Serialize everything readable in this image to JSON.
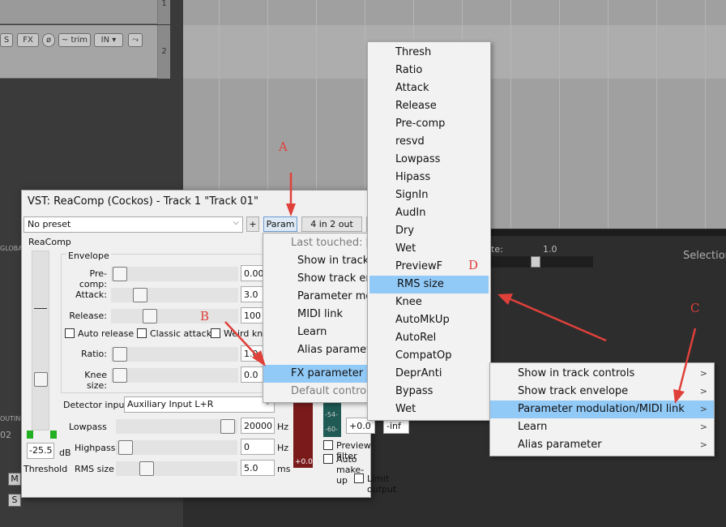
{
  "tcp": {
    "track1_num": "1",
    "track2_num": "2",
    "solo_label": "S",
    "fx_label": "FX",
    "trim_label": "trim",
    "input_label": "IN",
    "global_label": "GLOBAL",
    "routing_label": "OUTING",
    "mixer_num": "02",
    "mixer_m": "M",
    "mixer_s": "S"
  },
  "arrange": {
    "rate_label": "te:",
    "rate_value": "1.0",
    "selection_label": "Selection"
  },
  "fx_window": {
    "title": "VST: ReaComp (Cockos) - Track 1 \"Track 01\"",
    "preset": "No preset",
    "plus_label": "+",
    "param_label": "Param",
    "io_label": "4 in 2 out",
    "plugin_name": "ReaComp",
    "envelope_label": "Envelope",
    "precomp_label": "Pre-comp:",
    "precomp_value": "0.00",
    "attack_label": "Attack:",
    "attack_value": "3.0",
    "release_label": "Release:",
    "release_value": "100",
    "auto_release_label": "Auto release",
    "classic_attack_label": "Classic attack",
    "weird_knee_label": "Weird knee",
    "ratio_label": "Ratio:",
    "ratio_value": "1.0",
    "knee_label": "Knee size:",
    "knee_value": "0.0",
    "detector_label": "Detector input:",
    "detector_value": "Auxiliary Input L+R",
    "lowpass_label": "Lowpass",
    "lowpass_value": "20000",
    "highpass_label": "Highpass",
    "highpass_value": "0",
    "rms_label": "RMS size",
    "rms_value": "5.0",
    "hz_unit": "Hz",
    "ms_unit": "ms",
    "threshold_value": "-25.5",
    "threshold_db": "dB",
    "threshold_label": "Threshold",
    "meter_red_value": "+0.0",
    "meter_teal_top": "-54-",
    "meter_teal_bottom": "-60-",
    "out_value_1": "+0.0",
    "out_value_2": "-inf",
    "preview_filter_label": "Preview filter",
    "auto_makeup_label": "Auto make-up",
    "limit_output_label": "Limit output"
  },
  "param_menu": {
    "items": [
      {
        "label": "Last touched: [Th",
        "state": "disabled"
      },
      {
        "label": "Show in track c",
        "state": "normal"
      },
      {
        "label": "Show track env",
        "state": "normal"
      },
      {
        "label": "Parameter mod",
        "state": "normal"
      },
      {
        "label": "MIDI link",
        "state": "normal"
      },
      {
        "label": "Learn",
        "state": "normal"
      },
      {
        "label": "Alias paramete",
        "state": "normal"
      },
      {
        "label": "FX parameter lis",
        "state": "selected"
      },
      {
        "label": "Default controlle",
        "state": "disabled"
      }
    ]
  },
  "fx_param_list": {
    "items": [
      "Thresh",
      "Ratio",
      "Attack",
      "Release",
      "Pre-comp",
      "resvd",
      "Lowpass",
      "Hipass",
      "SignIn",
      "AudIn",
      "Dry",
      "Wet",
      "PreviewF",
      "RMS size",
      "Knee",
      "AutoMkUp",
      "AutoRel",
      "CompatOp",
      "DeprAnti",
      "Bypass",
      "Wet"
    ],
    "selected": "RMS size"
  },
  "param_submenu": {
    "items": [
      {
        "label": "Show in track controls",
        "selected": false
      },
      {
        "label": "Show track envelope",
        "selected": false
      },
      {
        "label": "Parameter modulation/MIDI link",
        "selected": true
      },
      {
        "label": "Learn",
        "selected": false
      },
      {
        "label": "Alias parameter",
        "selected": false
      }
    ]
  },
  "annotations": {
    "a": "A",
    "b": "B",
    "c": "C",
    "d": "D"
  },
  "colors": {
    "highlight": "#91c9f7",
    "annotation": "#e0403a",
    "menu_bg": "#f2f2f2",
    "green_led": "#22b022"
  }
}
